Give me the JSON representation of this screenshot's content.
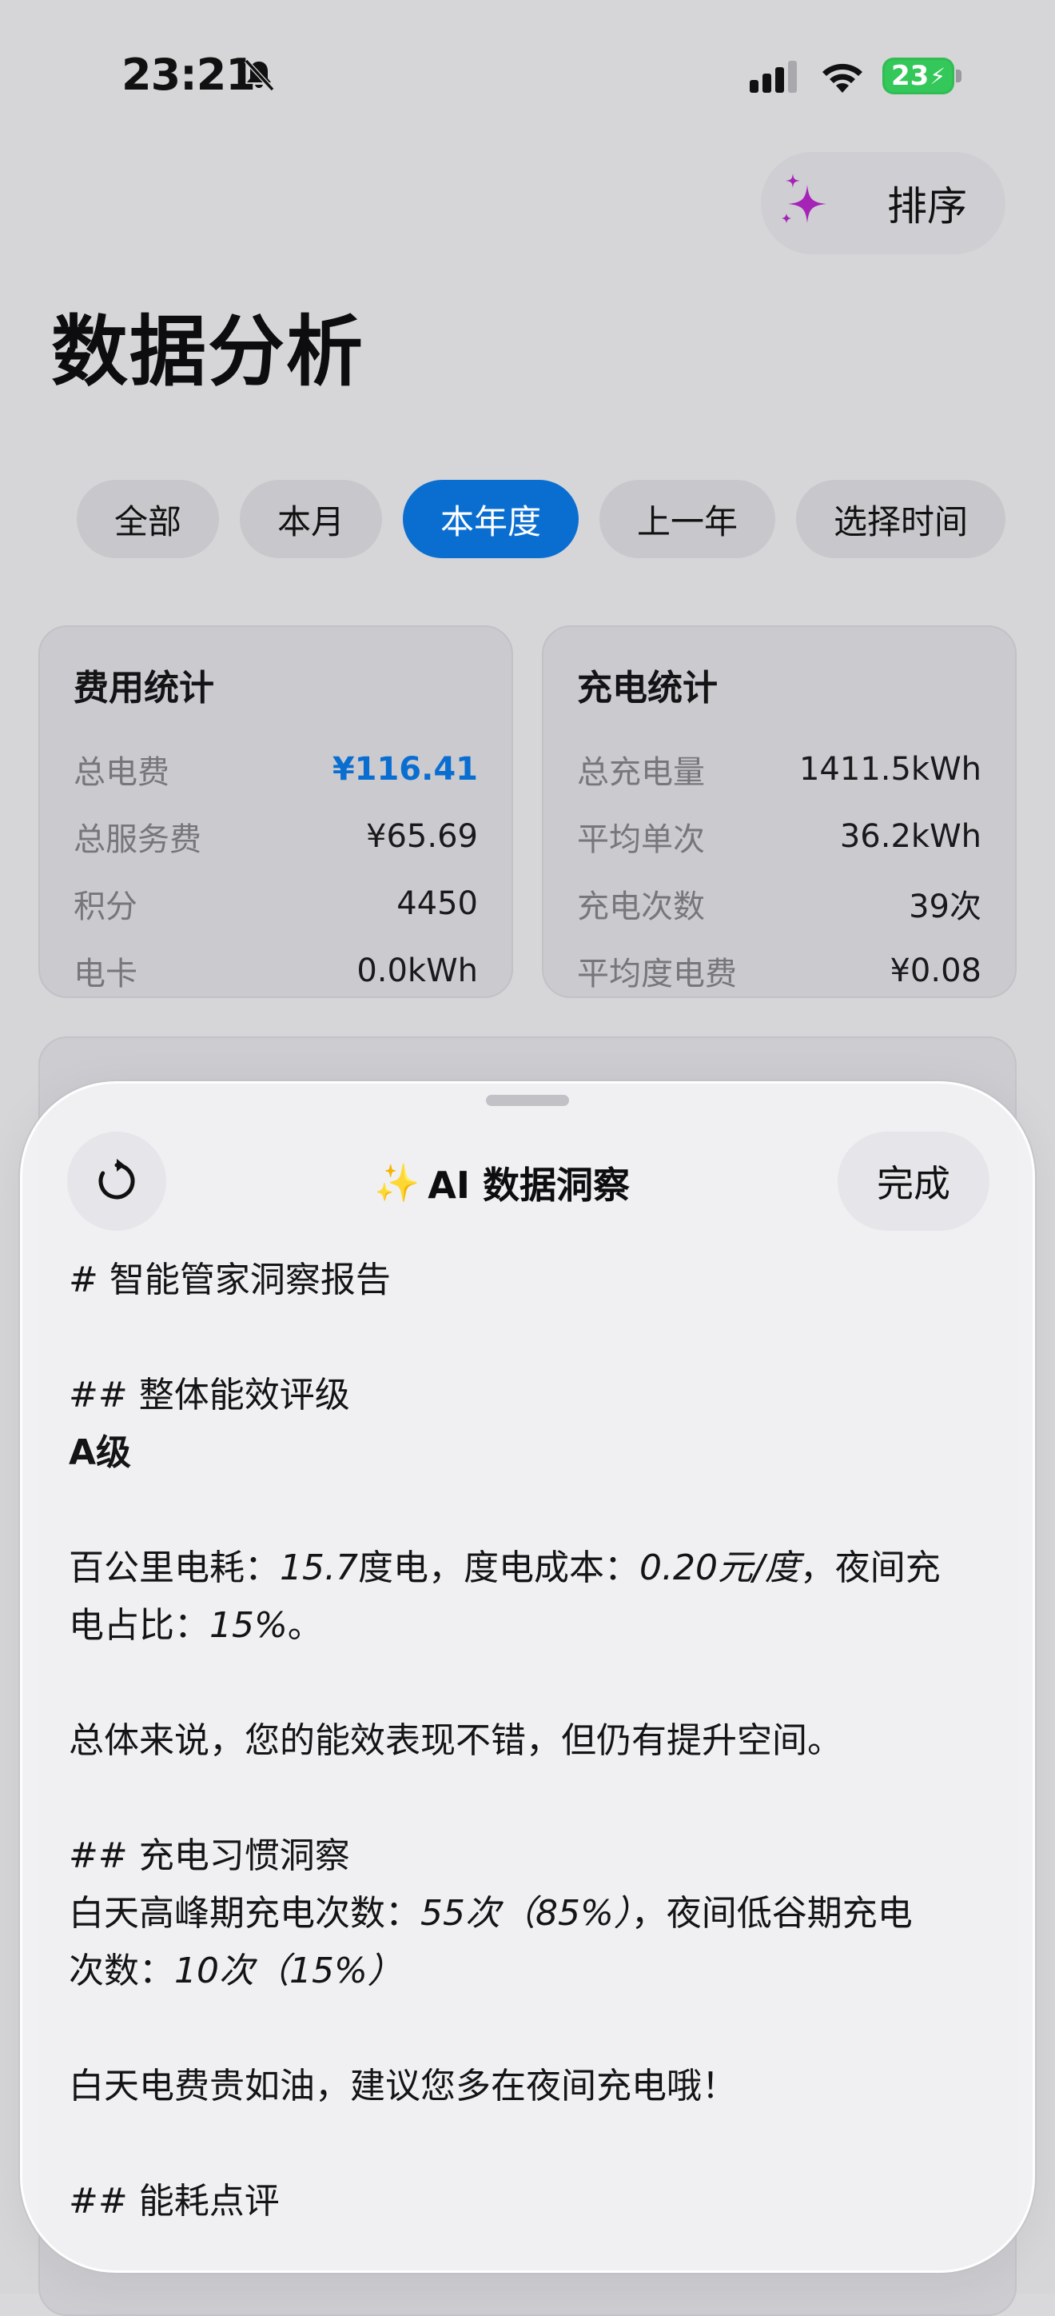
{
  "status_bar": {
    "time": "23:21",
    "battery": "23"
  },
  "header": {
    "sort_label": "排序",
    "title": "数据分析"
  },
  "filters": [
    {
      "label": "全部",
      "active": false
    },
    {
      "label": "本月",
      "active": false
    },
    {
      "label": "本年度",
      "active": true
    },
    {
      "label": "上一年",
      "active": false
    },
    {
      "label": "选择时间",
      "active": false
    }
  ],
  "cost_card": {
    "title": "费用统计",
    "rows": [
      {
        "label": "总电费",
        "value": "¥116.41"
      },
      {
        "label": "总服务费",
        "value": "¥65.69"
      },
      {
        "label": "积分",
        "value": "4450"
      },
      {
        "label": "电卡",
        "value": "0.0kWh"
      }
    ]
  },
  "charge_card": {
    "title": "充电统计",
    "rows": [
      {
        "label": "总充电量",
        "value": "1411.5kWh"
      },
      {
        "label": "平均单次",
        "value": "36.2kWh"
      },
      {
        "label": "充电次数",
        "value": "39次"
      },
      {
        "label": "平均度电费",
        "value": "¥0.08"
      }
    ]
  },
  "sheet": {
    "title_sparkles": "✨",
    "title": "AI 数据洞察",
    "done_label": "完成",
    "report": {
      "h1": "# 智能管家洞察报告",
      "h2_rating": "## 整体能效评级",
      "rating": "A级",
      "metrics_a1": "百公里电耗：",
      "metrics_v1": "15.7",
      "metrics_a2": "度电，度电成本：",
      "metrics_v2": "0.20元/度",
      "metrics_a3": "，夜间充",
      "metrics_b1": "电占比：",
      "metrics_v3": "15%",
      "metrics_b2": "。",
      "summary": "总体来说，您的能效表现不错，但仍有提升空间。",
      "h2_habit": "## 充电习惯洞察",
      "habit_a1": "白天高峰期充电次数：",
      "habit_v1": "55次（85%）",
      "habit_a2": "，夜间低谷期充电",
      "habit_b1": "次数：",
      "habit_v2": "10次（15%）",
      "advice": "白天电费贵如油，建议您多在夜间充电哦！",
      "h2_review": "## 能耗点评"
    }
  }
}
